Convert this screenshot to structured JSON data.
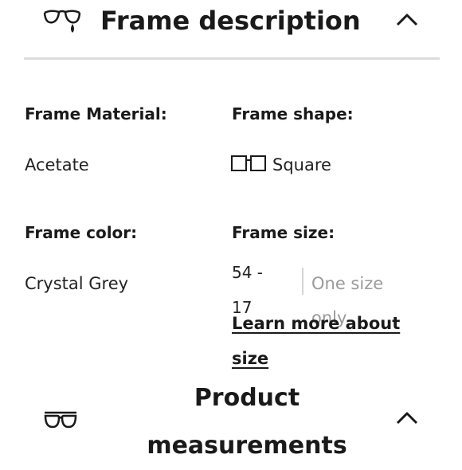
{
  "frame_description": {
    "title": "Frame description",
    "icons": {
      "section": "glasses-drop-icon",
      "toggle": "chevron-up-icon"
    }
  },
  "details": {
    "material_label": "Frame Material:",
    "material_value": "Acetate",
    "shape_label": "Frame shape:",
    "shape_value": "Square",
    "shape_icon": "square-frames-icon",
    "color_label": "Frame color:",
    "color_value": "Crystal Grey",
    "size_label": "Frame size:",
    "size_value": "54 - 17",
    "size_note_line1": "One size",
    "size_note_line2": "only",
    "learn_more": "Learn more about size"
  },
  "product_measurements": {
    "title": "Product measurements",
    "icons": {
      "section": "glasses-icon",
      "toggle": "chevron-up-icon"
    }
  },
  "colors": {
    "text": "#1a1a1a",
    "muted": "#9a9a9a",
    "divider": "#dcdcdc"
  }
}
